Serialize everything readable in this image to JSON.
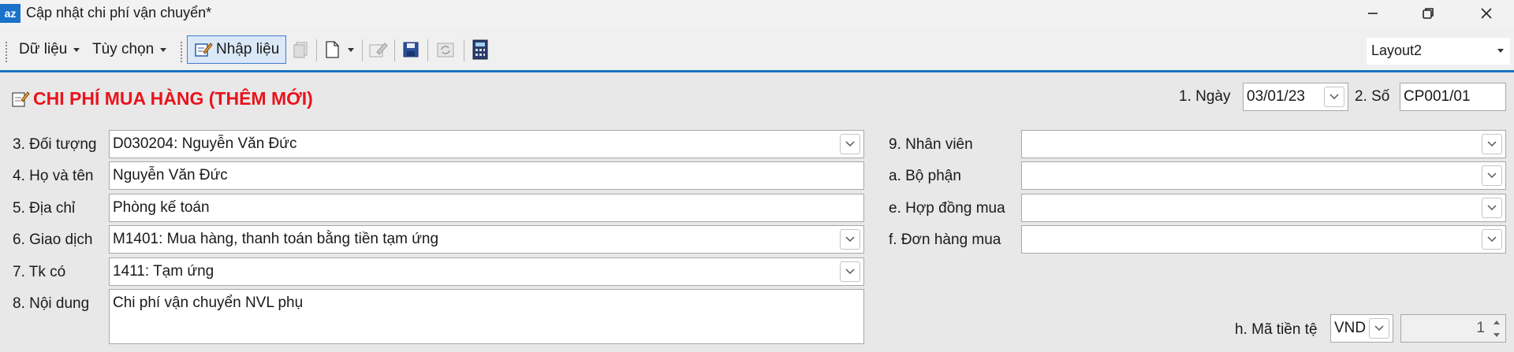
{
  "window": {
    "logo_text": "az",
    "title": "Cập nhật chi phí vận chuyển*"
  },
  "toolbar": {
    "menu_data": "Dữ liệu",
    "menu_options": "Tùy chọn",
    "input_button": "Nhập liệu",
    "layout_value": "Layout2"
  },
  "form": {
    "title": "CHI PHÍ MUA HÀNG (THÊM MỚI)",
    "date_label": "1. Ngày",
    "date_value": "03/01/23",
    "number_label": "2. Số",
    "number_value": "CP001/01",
    "left": [
      {
        "label": "3. Đối tượng",
        "value": "D030204: Nguyễn Văn Đức"
      },
      {
        "label": "4. Họ và tên",
        "value": "Nguyễn Văn Đức"
      },
      {
        "label": "5. Địa chỉ",
        "value": "Phòng kế toán"
      },
      {
        "label": "6. Giao dịch",
        "value": "M1401: Mua hàng,  thanh toán bằng tiền tạm ứng"
      },
      {
        "label": "7. Tk có",
        "value": "1411: Tạm ứng"
      },
      {
        "label": "8. Nội dung",
        "value": "Chi phí vận chuyển NVL phụ"
      }
    ],
    "right": [
      {
        "label": "9. Nhân viên",
        "value": ""
      },
      {
        "label": "a. Bộ phận",
        "value": ""
      },
      {
        "label": "e. Hợp đồng mua",
        "value": ""
      },
      {
        "label": "f. Đơn hàng mua",
        "value": ""
      }
    ],
    "currency_label": "h. Mã tiền tệ",
    "currency_value": "VND",
    "rate_value": "1"
  },
  "colors": {
    "title_red": "#e8141c",
    "accent_blue": "#1a72c0"
  }
}
